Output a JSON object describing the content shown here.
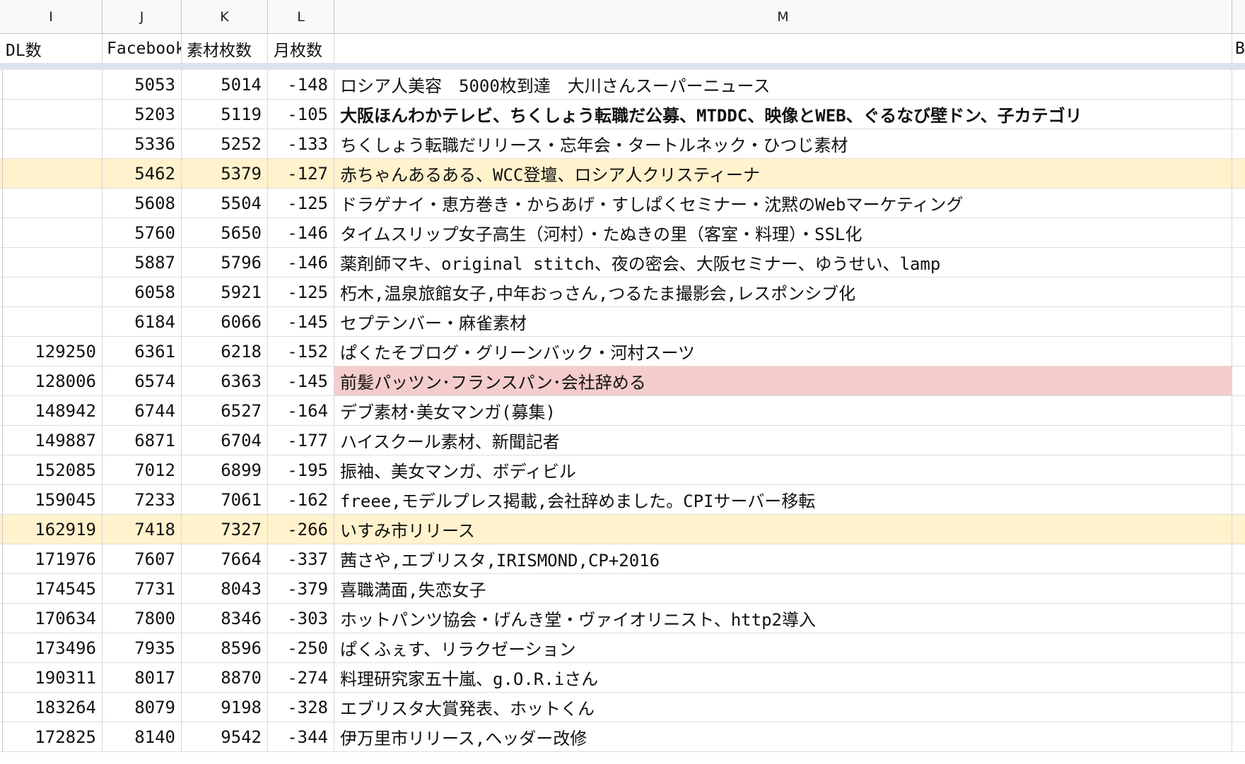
{
  "columns": {
    "I": "I",
    "J": "J",
    "K": "K",
    "L": "L",
    "M": "M"
  },
  "headers": {
    "dl": "DL数",
    "facebook": "Facebook",
    "sozai": "素材枚数",
    "tsuki": "月枚数",
    "m": "",
    "next": "B"
  },
  "colors": {
    "highlight_yellow": "#fff2cc",
    "highlight_pink": "#f4cccc"
  },
  "rows": [
    {
      "dl": "",
      "fb": "5053",
      "sozai": "5014",
      "tsuki": "-148",
      "memo": "ロシア人美容　5000枚到達　大川さんスーパーニュース",
      "highlight": "",
      "bold": false,
      "pink": false
    },
    {
      "dl": "",
      "fb": "5203",
      "sozai": "5119",
      "tsuki": "-105",
      "memo": "大阪ほんわかテレビ、ちくしょう転職だ公募、MTDDC、映像とWEB、ぐるなび壁ドン、子カテゴリ",
      "highlight": "",
      "bold": true,
      "pink": false
    },
    {
      "dl": "",
      "fb": "5336",
      "sozai": "5252",
      "tsuki": "-133",
      "memo": "ちくしょう転職だリリース・忘年会・タートルネック・ひつじ素材",
      "highlight": "",
      "bold": false,
      "pink": false
    },
    {
      "dl": "",
      "fb": "5462",
      "sozai": "5379",
      "tsuki": "-127",
      "memo": "赤ちゃんあるある、WCC登壇、ロシア人クリスティーナ",
      "highlight": "yellow",
      "bold": false,
      "pink": false
    },
    {
      "dl": "",
      "fb": "5608",
      "sozai": "5504",
      "tsuki": "-125",
      "memo": "ドラゲナイ・恵方巻き・からあげ・すしぱくセミナー・沈黙のWebマーケティング",
      "highlight": "",
      "bold": false,
      "pink": false
    },
    {
      "dl": "",
      "fb": "5760",
      "sozai": "5650",
      "tsuki": "-146",
      "memo": "タイムスリップ女子高生（河村）・たぬきの里（客室・料理）・SSL化",
      "highlight": "",
      "bold": false,
      "pink": false
    },
    {
      "dl": "",
      "fb": "5887",
      "sozai": "5796",
      "tsuki": "-146",
      "memo": "薬剤師マキ、original stitch、夜の密会、大阪セミナー、ゆうせい、lamp",
      "highlight": "",
      "bold": false,
      "pink": false
    },
    {
      "dl": "",
      "fb": "6058",
      "sozai": "5921",
      "tsuki": "-125",
      "memo": "朽木,温泉旅館女子,中年おっさん,つるたま撮影会,レスポンシブ化",
      "highlight": "",
      "bold": false,
      "pink": false
    },
    {
      "dl": "",
      "fb": "6184",
      "sozai": "6066",
      "tsuki": "-145",
      "memo": "セプテンバー・麻雀素材",
      "highlight": "",
      "bold": false,
      "pink": false
    },
    {
      "dl": "129250",
      "fb": "6361",
      "sozai": "6218",
      "tsuki": "-152",
      "memo": "ぱくたそブログ・グリーンバック・河村スーツ",
      "highlight": "",
      "bold": false,
      "pink": false
    },
    {
      "dl": "128006",
      "fb": "6574",
      "sozai": "6363",
      "tsuki": "-145",
      "memo": "前髪パッツン･フランスパン･会社辞める",
      "highlight": "",
      "bold": false,
      "pink": true
    },
    {
      "dl": "148942",
      "fb": "6744",
      "sozai": "6527",
      "tsuki": "-164",
      "memo": "デブ素材･美女マンガ(募集)",
      "highlight": "",
      "bold": false,
      "pink": false
    },
    {
      "dl": "149887",
      "fb": "6871",
      "sozai": "6704",
      "tsuki": "-177",
      "memo": "ハイスクール素材、新聞記者",
      "highlight": "",
      "bold": false,
      "pink": false
    },
    {
      "dl": "152085",
      "fb": "7012",
      "sozai": "6899",
      "tsuki": "-195",
      "memo": "振袖、美女マンガ、ボディビル",
      "highlight": "",
      "bold": false,
      "pink": false
    },
    {
      "dl": "159045",
      "fb": "7233",
      "sozai": "7061",
      "tsuki": "-162",
      "memo": "freee,モデルプレス掲載,会社辞めました。CPIサーバー移転",
      "highlight": "",
      "bold": false,
      "pink": false
    },
    {
      "dl": "162919",
      "fb": "7418",
      "sozai": "7327",
      "tsuki": "-266",
      "memo": "いすみ市リリース",
      "highlight": "yellow",
      "bold": false,
      "pink": false
    },
    {
      "dl": "171976",
      "fb": "7607",
      "sozai": "7664",
      "tsuki": "-337",
      "memo": "茜さや,エブリスタ,IRISMOND,CP+2016",
      "highlight": "",
      "bold": false,
      "pink": false
    },
    {
      "dl": "174545",
      "fb": "7731",
      "sozai": "8043",
      "tsuki": "-379",
      "memo": "喜職満面,失恋女子",
      "highlight": "",
      "bold": false,
      "pink": false
    },
    {
      "dl": "170634",
      "fb": "7800",
      "sozai": "8346",
      "tsuki": "-303",
      "memo": "ホットパンツ協会・げんき堂・ヴァイオリニスト、http2導入",
      "highlight": "",
      "bold": false,
      "pink": false
    },
    {
      "dl": "173496",
      "fb": "7935",
      "sozai": "8596",
      "tsuki": "-250",
      "memo": "ぱくふぇす、リラクゼーション",
      "highlight": "",
      "bold": false,
      "pink": false
    },
    {
      "dl": "190311",
      "fb": "8017",
      "sozai": "8870",
      "tsuki": "-274",
      "memo": "料理研究家五十嵐、g.O.R.iさん",
      "highlight": "",
      "bold": false,
      "pink": false
    },
    {
      "dl": "183264",
      "fb": "8079",
      "sozai": "9198",
      "tsuki": "-328",
      "memo": "エブリスタ大賞発表、ホットくん",
      "highlight": "",
      "bold": false,
      "pink": false
    },
    {
      "dl": "172825",
      "fb": "8140",
      "sozai": "9542",
      "tsuki": "-344",
      "memo": "伊万里市リリース,ヘッダー改修",
      "highlight": "",
      "bold": false,
      "pink": false
    }
  ]
}
